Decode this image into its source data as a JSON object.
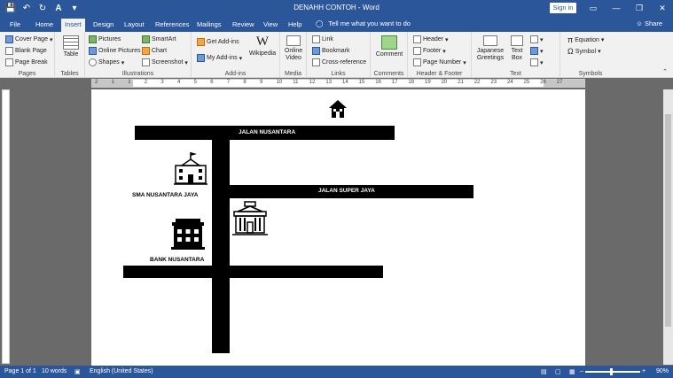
{
  "window": {
    "title": "DENAHH CONTOH - Word",
    "signin_label": "Sign in"
  },
  "tabs": [
    "File",
    "Home",
    "Insert",
    "Design",
    "Layout",
    "References",
    "Mailings",
    "Review",
    "View",
    "Help"
  ],
  "active_tab": "Insert",
  "tellme": "Tell me what you want to do",
  "share_label": "Share",
  "ribbon": {
    "pages": {
      "label": "Pages",
      "items": [
        "Cover Page",
        "Blank Page",
        "Page Break"
      ]
    },
    "tables": {
      "label": "Tables",
      "item": "Table"
    },
    "illustrations": {
      "label": "Illustrations",
      "items": [
        "Pictures",
        "Online Pictures",
        "Shapes",
        "SmartArt",
        "Chart",
        "Screenshot"
      ]
    },
    "addins": {
      "label": "Add-ins",
      "items": [
        "Get Add-ins",
        "My Add-ins",
        "Wikipedia"
      ]
    },
    "media": {
      "label": "Media",
      "item": "Online Video"
    },
    "links": {
      "label": "Links",
      "items": [
        "Link",
        "Bookmark",
        "Cross-reference"
      ]
    },
    "comments": {
      "label": "Comments",
      "item": "Comment"
    },
    "header_footer": {
      "label": "Header & Footer",
      "items": [
        "Header",
        "Footer",
        "Page Number"
      ]
    },
    "text": {
      "label": "Text",
      "items": [
        "Japanese Greetings",
        "Text Box"
      ]
    },
    "symbols": {
      "label": "Symbols",
      "items": [
        "Equation",
        "Symbol"
      ]
    }
  },
  "ruler_numbers": [
    "2",
    "1",
    "1",
    "2",
    "3",
    "4",
    "5",
    "6",
    "7",
    "8",
    "9",
    "10",
    "11",
    "12",
    "13",
    "14",
    "15",
    "16",
    "17",
    "18",
    "19",
    "20",
    "21",
    "22",
    "23",
    "24",
    "25",
    "26",
    "27"
  ],
  "map": {
    "road1": "JALAN NUSANTARA",
    "road2": "JALAN SUPER JAYA",
    "school": "SMA NUSANTARA JAYA",
    "bank": "BANK NUSANTARA"
  },
  "status": {
    "page": "Page 1 of 1",
    "words": "10 words",
    "language": "English (United States)",
    "zoom": "90%"
  }
}
